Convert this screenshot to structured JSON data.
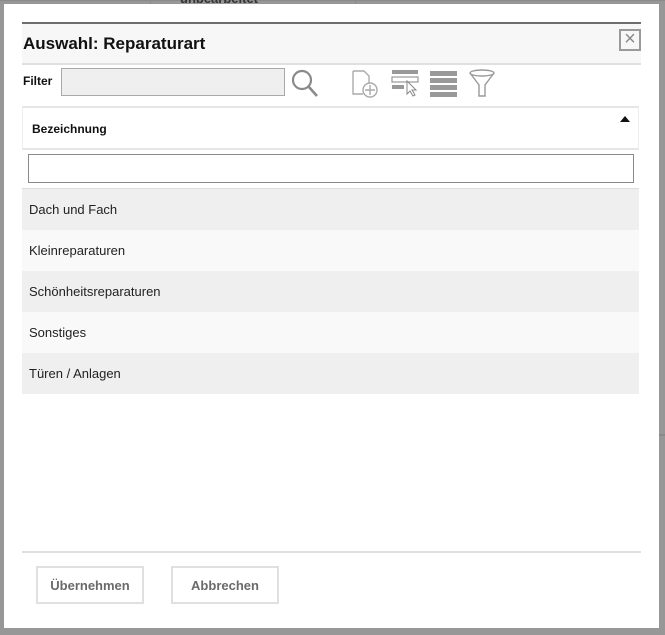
{
  "background": {
    "text": "unbearbeitet"
  },
  "dialog": {
    "title": "Auswahl: Reparaturart",
    "close_icon": "close-icon",
    "filter": {
      "label": "Filter",
      "value": ""
    },
    "toolbar": {
      "icons": [
        "search-icon",
        "new-document-icon",
        "select-row-icon",
        "list-icon",
        "filter-funnel-icon"
      ]
    },
    "grid": {
      "column": "Bezeichnung",
      "sort": "ascending",
      "column_filter_value": "",
      "rows": [
        "Dach und Fach",
        "Kleinreparaturen",
        "Schönheitsreparaturen",
        "Sonstiges",
        "Türen / Anlagen"
      ]
    },
    "buttons": {
      "accept": "Übernehmen",
      "cancel": "Abbrechen"
    }
  }
}
